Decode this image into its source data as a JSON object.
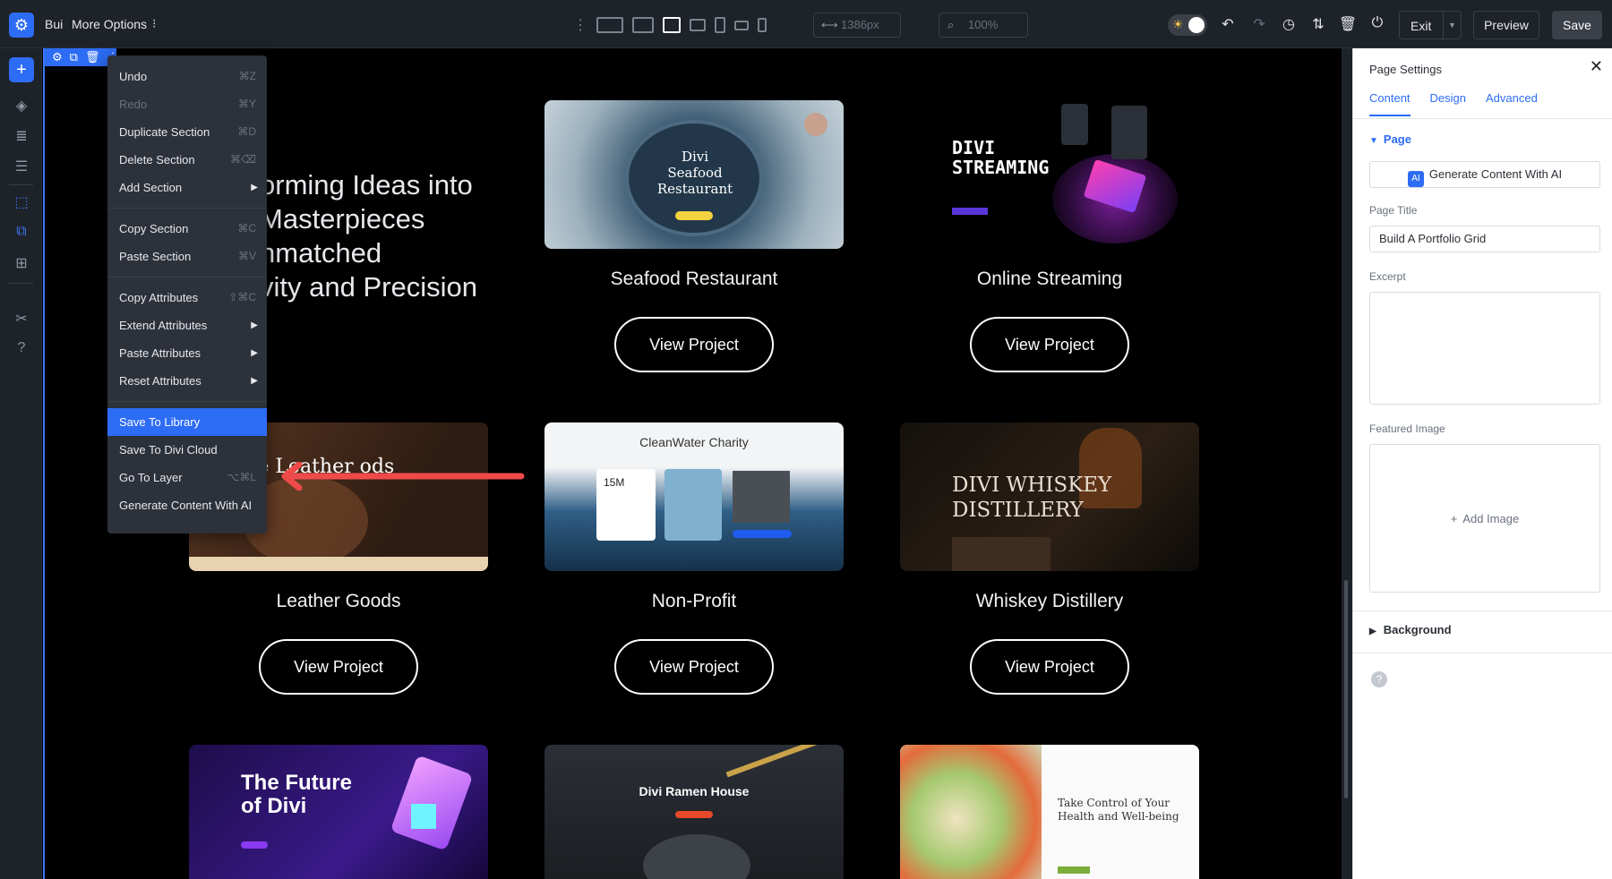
{
  "app": {
    "title": "Bui",
    "more_options": "More Options",
    "kebab": "⁝"
  },
  "toolbar": {
    "width_value": "1386px",
    "zoom_value": "100%",
    "exit_label": "Exit",
    "preview_label": "Preview",
    "save_label": "Save"
  },
  "hero": {
    "line1": "orming Ideas into",
    "line2": "Masterpieces",
    "line3": "nmatched",
    "line4": "vity and Precision"
  },
  "context_menu": {
    "items": [
      {
        "label": "Undo",
        "shortcut": "⌘Z"
      },
      {
        "label": "Redo",
        "shortcut": "⌘Y"
      },
      {
        "label": "Duplicate Section",
        "shortcut": "⌘D"
      },
      {
        "label": "Delete Section",
        "shortcut": "⌘⌫"
      },
      {
        "label": "Add Section",
        "shortcut": ""
      },
      {
        "label": "Copy Section",
        "shortcut": "⌘C"
      },
      {
        "label": "Paste Section",
        "shortcut": "⌘V"
      },
      {
        "label": "Copy Attributes",
        "shortcut": "⇧⌘C"
      },
      {
        "label": "Extend Attributes",
        "shortcut": ""
      },
      {
        "label": "Paste Attributes",
        "shortcut": ""
      },
      {
        "label": "Reset Attributes",
        "shortcut": ""
      },
      {
        "label": "Save To Library",
        "shortcut": ""
      },
      {
        "label": "Save To Divi Cloud",
        "shortcut": ""
      },
      {
        "label": "Go To Layer",
        "shortcut": "⌥⌘L"
      },
      {
        "label": "Generate Content With AI",
        "shortcut": ""
      }
    ]
  },
  "portfolio": {
    "button_label": "View Project",
    "cards": [
      {
        "name": "Seafood Restaurant",
        "thumb_title": "Divi Seafood Restaurant"
      },
      {
        "name": "Online Streaming",
        "thumb_title": "DIVI STREAMING"
      },
      {
        "name": "Leather Goods",
        "thumb_title": "ndmade Leather ods"
      },
      {
        "name": "Non-Profit",
        "thumb_title": "CleanWater Charity",
        "thumb_stat": "15M"
      },
      {
        "name": "Whiskey Distillery",
        "thumb_title": "DIVI WHISKEY DISTILLERY"
      },
      {
        "name": "",
        "thumb_title": "The Future of Divi"
      },
      {
        "name": "",
        "thumb_title": "Divi Ramen House"
      },
      {
        "name": "",
        "thumb_title": "Take Control of Your Health and Well-being"
      }
    ]
  },
  "page_settings": {
    "title": "Page Settings",
    "tabs": [
      "Content",
      "Design",
      "Advanced"
    ],
    "page_section": "Page",
    "ai_button": "Generate Content With AI",
    "ai_badge": "AI",
    "page_title_label": "Page Title",
    "page_title_value": "Build A Portfolio Grid",
    "excerpt_label": "Excerpt",
    "featured_image_label": "Featured Image",
    "add_image_label": "Add Image",
    "background_section": "Background"
  },
  "icons": {
    "logo": "gear-icon",
    "add": "plus-icon",
    "close": "close-icon",
    "help": "help-icon"
  }
}
